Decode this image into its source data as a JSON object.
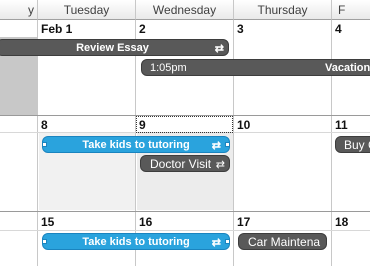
{
  "headers": [
    "y",
    "Tuesday",
    "Wednesday",
    "Thursday",
    "F"
  ],
  "week1": {
    "days": [
      "Feb 1",
      "2",
      "3",
      "4"
    ]
  },
  "week2": {
    "days": [
      "8",
      "9",
      "10",
      "11"
    ]
  },
  "week3": {
    "days": [
      "15",
      "16",
      "17",
      "18"
    ]
  },
  "events": {
    "review_essay": "Review Essay",
    "vacation_time": "1:05pm",
    "vacation_title": "Vacation",
    "tutoring_1": "Take kids to tutoring",
    "doctor_visit": "Doctor Visit",
    "buy": "Buy C",
    "tutoring_2": "Take kids to tutoring",
    "car_maint": "Car Maintena"
  },
  "icons": {
    "recurring": "recurring-icon"
  },
  "colors": {
    "event_dark": "#595959",
    "event_blue": "#2aa3dd",
    "header_bg": "#e9e9e9"
  }
}
